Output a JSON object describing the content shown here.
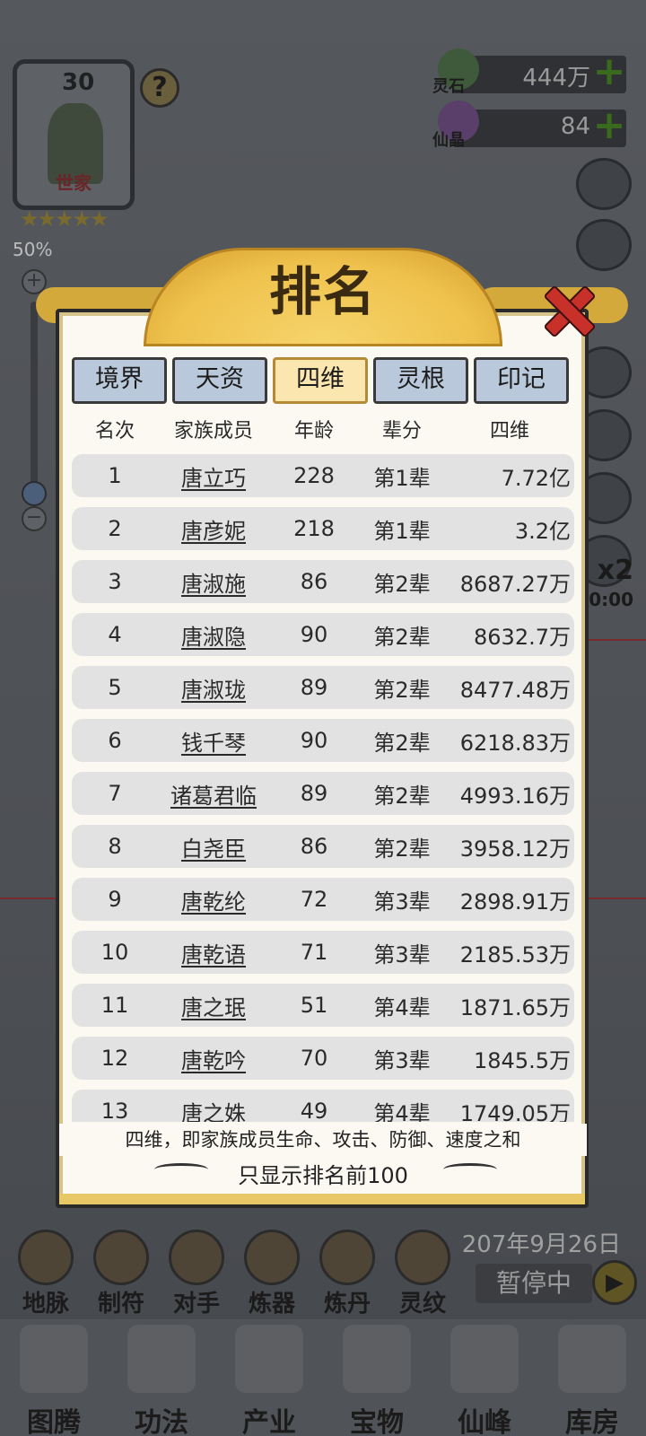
{
  "clan": {
    "level": "30",
    "tier": "世家",
    "stars": "★★★★★",
    "help": "?"
  },
  "zoom": {
    "percent": "50%",
    "plus": "+",
    "minus": "−",
    "level": 0.5
  },
  "resources": [
    {
      "name": "灵石",
      "value": "444万",
      "add": "+"
    },
    {
      "name": "仙晶",
      "value": "84",
      "add": "+"
    }
  ],
  "speed": {
    "label": "x2",
    "timer": "0:00"
  },
  "modal": {
    "title": "排名",
    "tabs": [
      "境界",
      "天资",
      "四维",
      "灵根",
      "印记"
    ],
    "active_tab": "四维",
    "columns": [
      "名次",
      "家族成员",
      "年龄",
      "辈分",
      "四维"
    ],
    "rows": [
      {
        "rank": "1",
        "name": "唐立巧",
        "age": "228",
        "gen": "第1辈",
        "stat": "7.72亿"
      },
      {
        "rank": "2",
        "name": "唐彦妮",
        "age": "218",
        "gen": "第1辈",
        "stat": "3.2亿"
      },
      {
        "rank": "3",
        "name": "唐淑施",
        "age": "86",
        "gen": "第2辈",
        "stat": "8687.27万"
      },
      {
        "rank": "4",
        "name": "唐淑隐",
        "age": "90",
        "gen": "第2辈",
        "stat": "8632.7万"
      },
      {
        "rank": "5",
        "name": "唐淑珑",
        "age": "89",
        "gen": "第2辈",
        "stat": "8477.48万"
      },
      {
        "rank": "6",
        "name": "钱千琴",
        "age": "90",
        "gen": "第2辈",
        "stat": "6218.83万"
      },
      {
        "rank": "7",
        "name": "诸葛君临",
        "age": "89",
        "gen": "第2辈",
        "stat": "4993.16万"
      },
      {
        "rank": "8",
        "name": "白尧臣",
        "age": "86",
        "gen": "第2辈",
        "stat": "3958.12万"
      },
      {
        "rank": "9",
        "name": "唐乾纶",
        "age": "72",
        "gen": "第3辈",
        "stat": "2898.91万"
      },
      {
        "rank": "10",
        "name": "唐乾语",
        "age": "71",
        "gen": "第3辈",
        "stat": "2185.53万"
      },
      {
        "rank": "11",
        "name": "唐之珉",
        "age": "51",
        "gen": "第4辈",
        "stat": "1871.65万"
      },
      {
        "rank": "12",
        "name": "唐乾吟",
        "age": "70",
        "gen": "第3辈",
        "stat": "1845.5万"
      },
      {
        "rank": "13",
        "name": "唐之姝",
        "age": "49",
        "gen": "第4辈",
        "stat": "1749.05万"
      }
    ],
    "note": "四维，即家族成员生命、攻击、防御、速度之和",
    "limit": "只显示排名前100"
  },
  "date": "207年9月26日",
  "pause_label": "暂停中",
  "play_icon": "▶",
  "functions": [
    "地脉",
    "制符",
    "对手",
    "炼器",
    "炼丹",
    "灵纹"
  ],
  "nav": [
    "图腾",
    "功法",
    "产业",
    "宝物",
    "仙峰",
    "库房"
  ]
}
